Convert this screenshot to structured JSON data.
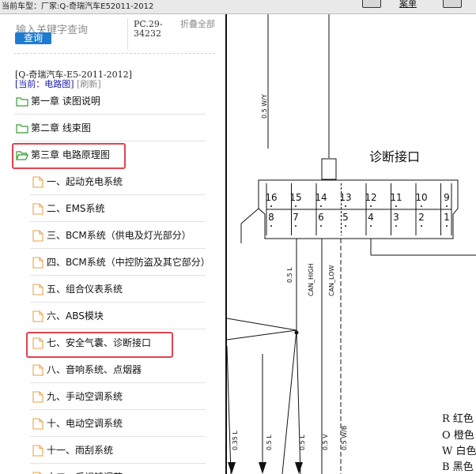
{
  "topbar": {
    "current_model_label": "当前车型：",
    "maker_label": "厂家:Q-奇瑞汽车E52011-2012",
    "button_text": "案单"
  },
  "search": {
    "placeholder": "输入关键字查询",
    "button": "查询",
    "pc_code": "PC.29-34232",
    "collapse_all": "折叠全部"
  },
  "breadcrumb": {
    "model": "[Q-奇瑞汽车-E5-2011-2012]",
    "current_prefix": "[当前：",
    "current_value": "电路图",
    "current_suffix": "]",
    "refresh": "[刷新]"
  },
  "tree": {
    "chapters": [
      {
        "label": "第一章 读图说明"
      },
      {
        "label": "第二章 线束图"
      },
      {
        "label": "第三章 电路原理图"
      }
    ],
    "sections": [
      {
        "label": "一、起动充电系统"
      },
      {
        "label": "二、EMS系统"
      },
      {
        "label": "三、BCM系统（供电及灯光部分）"
      },
      {
        "label": "四、BCM系统（中控防盗及其它部分）"
      },
      {
        "label": "五、组合仪表系统"
      },
      {
        "label": "六、ABS模块"
      },
      {
        "label": "七、安全气囊、诊断接口"
      },
      {
        "label": "八、音响系统、点烟器"
      },
      {
        "label": "九、手动空调系统"
      },
      {
        "label": "十、电动空调系统"
      },
      {
        "label": "十一、雨刮系统"
      },
      {
        "label": "十二、后视镜调节"
      }
    ]
  },
  "diagram": {
    "title": "诊断接口",
    "pins_top": [
      "16",
      "15",
      "14",
      "13",
      "12",
      "11",
      "10",
      "9"
    ],
    "pins_bottom": [
      "8",
      "7",
      "6",
      "5",
      "4",
      "3",
      "2",
      "1"
    ],
    "wire_labels": {
      "top_wire": "0.5 W/Y",
      "can_high": "CAN_HIGH",
      "can_low": "CAN_LOW",
      "left_wire": "0.5 L",
      "bottom": [
        "0.35 L",
        "0.5 L",
        "0.5 L",
        "0.5 V",
        "0.5 W/B"
      ]
    },
    "legend": [
      "R 红色",
      "O 橙色",
      "W 白色",
      "B 黑色"
    ]
  },
  "colors": {
    "accent": "#1f7bd0",
    "highlight": "#e0434f",
    "folder": "#3a9c34",
    "page": "#e8a24b"
  }
}
